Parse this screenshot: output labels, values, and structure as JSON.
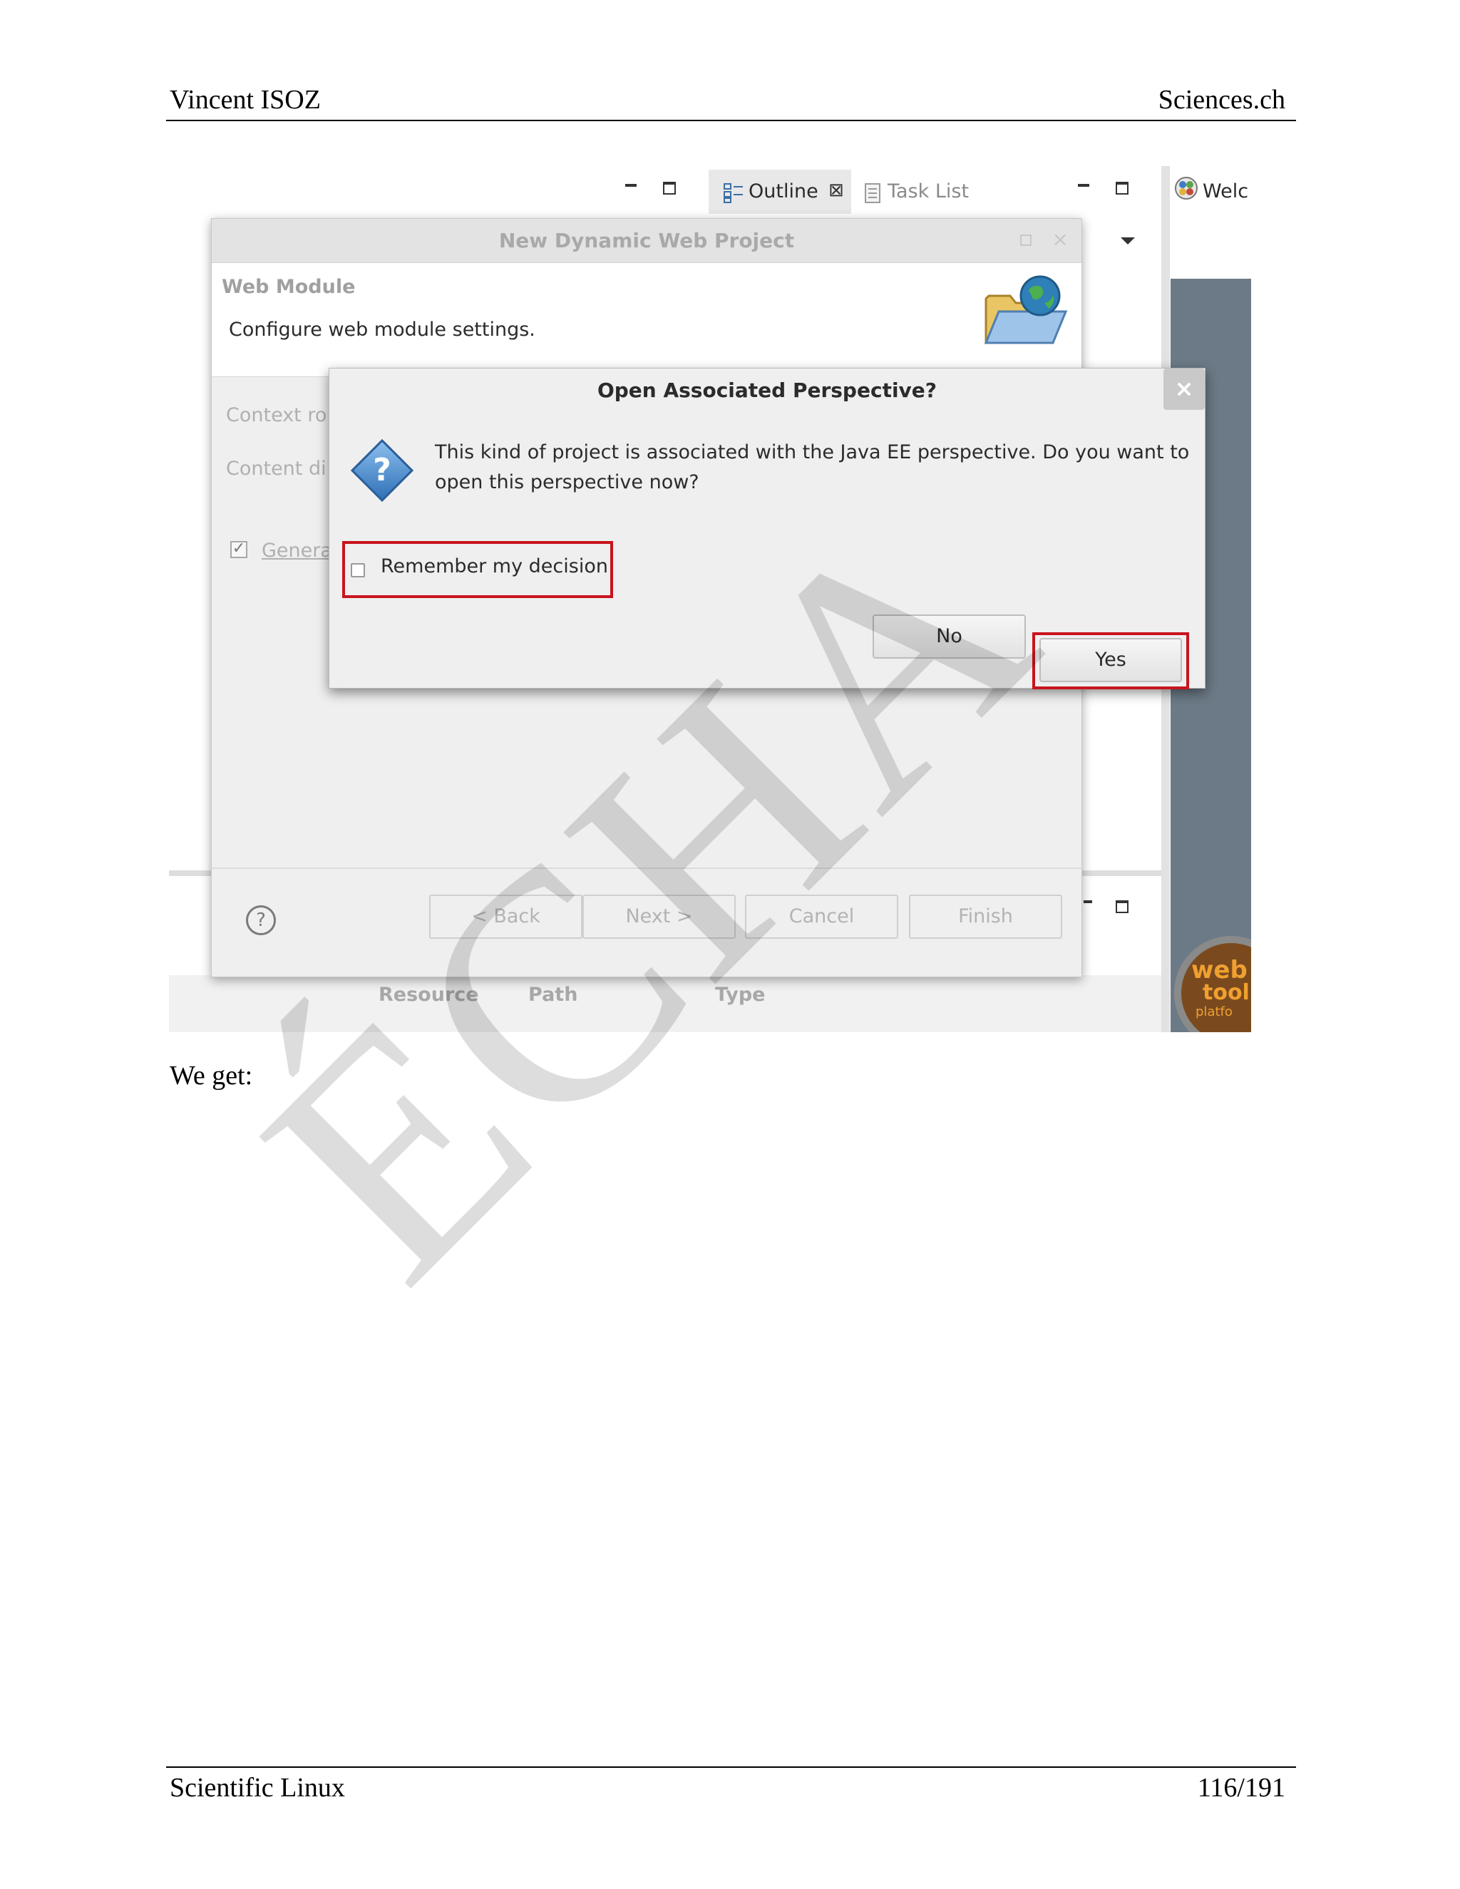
{
  "header": {
    "left": "Vincent ISOZ",
    "right": "Sciences.ch"
  },
  "footer": {
    "left": "Scientific Linux",
    "right": "116/191"
  },
  "watermark": "ÉCHA",
  "body_text": "We get:",
  "eclipse": {
    "tab_outline": "Outline",
    "tab_tasklist": "Task List",
    "tab_welcome": "Welc",
    "problems_columns": [
      "Resource",
      "Path",
      "Type"
    ],
    "logo_text": [
      "web",
      "tool",
      "platfo"
    ]
  },
  "wizard": {
    "title": "New Dynamic Web Project",
    "section": "Web Module",
    "description": "Configure web module settings.",
    "context_root_label": "Context ro",
    "content_dir_label": "Content di",
    "generate_label": "Genera",
    "buttons": {
      "back": "< Back",
      "next": "Next >",
      "cancel": "Cancel",
      "finish": "Finish"
    }
  },
  "dialog": {
    "title": "Open Associated Perspective?",
    "message": "This kind of project is associated with the Java EE perspective.  Do you want to open this perspective now?",
    "remember": "Remember my decision",
    "no": "No",
    "yes": "Yes",
    "close_symbol": "×"
  },
  "colors": {
    "highlight": "#c8141e",
    "side_panel": "#6b7a86"
  }
}
